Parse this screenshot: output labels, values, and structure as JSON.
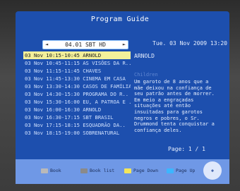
{
  "header": {
    "title": "Program Guide"
  },
  "channel": {
    "label": "04.01 SBT HD",
    "left_arrow": "◄",
    "right_arrow": "►"
  },
  "datetime": "Tue.  03 Nov 2009 13:20",
  "programs": [
    "03 Nov 10:15-10:45 ARNOLD",
    "03 Nov 10:45-11:15 AS VISÕES DA R..",
    "03 Nov 11:15-11:45 CHAVES",
    "03 Nov 11:45-13:30 CINEMA EM CASA",
    "03 Nov 13:30-14:30 CASOS DE FAMÍLIA",
    "03 Nov 14:30-15:30 PROGRAMA DO R..",
    "03 Nov 15:30-16:00 EU, A PATROA E ..",
    "03 Nov 16:00-16:30 ARNOLD",
    "03 Nov 16:30-17:15 SBT BRASIL",
    "03 Nov 17:15-18:15 ESQUADRÃO DA..",
    "03 Nov 18:15-19:00 SOBRENATURAL"
  ],
  "detail": {
    "title": "ARNOLD",
    "genre": "Children",
    "text": "Um garoto de 8 anos que a mãe deixou na confiança de seu patrão antes de morrer. Em meio a engraçadas situações até então insuitadas para garotos negros e pobres, o Sr. Drummond tenta conquistar a confiança deles."
  },
  "pagination": "Page: 1 / 1",
  "buttons": {
    "book": "Book",
    "book_list": "Book list",
    "page_down": "Page Down",
    "page_up": "Page Up"
  },
  "colors": {
    "panel": "#1d4fae",
    "selection": "#f3f09a",
    "key_book": "#b9b9b9",
    "key_book_list": "#8a8a8a",
    "key_page_down": "#f3e65a",
    "key_page_up": "#3cb6ff"
  }
}
